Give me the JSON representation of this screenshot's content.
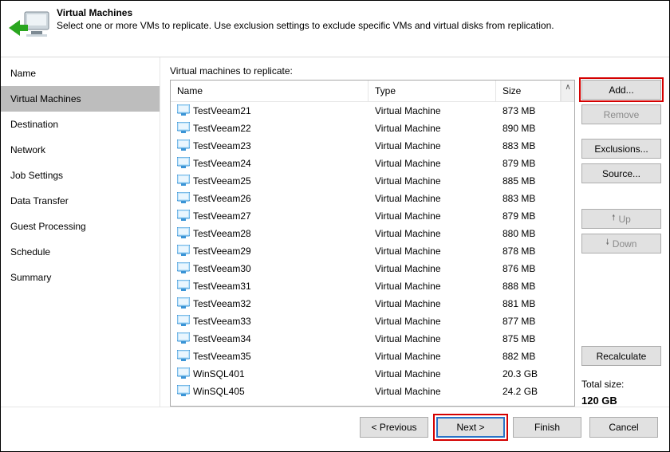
{
  "header": {
    "title": "Virtual Machines",
    "subtitle": "Select one or more VMs to replicate. Use exclusion settings to exclude specific VMs and virtual disks from replication."
  },
  "nav": {
    "items": [
      {
        "label": "Name",
        "selected": false
      },
      {
        "label": "Virtual Machines",
        "selected": true
      },
      {
        "label": "Destination",
        "selected": false
      },
      {
        "label": "Network",
        "selected": false
      },
      {
        "label": "Job Settings",
        "selected": false
      },
      {
        "label": "Data Transfer",
        "selected": false
      },
      {
        "label": "Guest Processing",
        "selected": false
      },
      {
        "label": "Schedule",
        "selected": false
      },
      {
        "label": "Summary",
        "selected": false
      }
    ]
  },
  "main": {
    "caption": "Virtual machines to replicate:",
    "columns": {
      "name": "Name",
      "type": "Type",
      "size": "Size"
    },
    "rows": [
      {
        "name": "TestVeeam21",
        "type": "Virtual Machine",
        "size": "873 MB"
      },
      {
        "name": "TestVeeam22",
        "type": "Virtual Machine",
        "size": "890 MB"
      },
      {
        "name": "TestVeeam23",
        "type": "Virtual Machine",
        "size": "883 MB"
      },
      {
        "name": "TestVeeam24",
        "type": "Virtual Machine",
        "size": "879 MB"
      },
      {
        "name": "TestVeeam25",
        "type": "Virtual Machine",
        "size": "885 MB"
      },
      {
        "name": "TestVeeam26",
        "type": "Virtual Machine",
        "size": "883 MB"
      },
      {
        "name": "TestVeeam27",
        "type": "Virtual Machine",
        "size": "879 MB"
      },
      {
        "name": "TestVeeam28",
        "type": "Virtual Machine",
        "size": "880 MB"
      },
      {
        "name": "TestVeeam29",
        "type": "Virtual Machine",
        "size": "878 MB"
      },
      {
        "name": "TestVeeam30",
        "type": "Virtual Machine",
        "size": "876 MB"
      },
      {
        "name": "TestVeeam31",
        "type": "Virtual Machine",
        "size": "888 MB"
      },
      {
        "name": "TestVeeam32",
        "type": "Virtual Machine",
        "size": "881 MB"
      },
      {
        "name": "TestVeeam33",
        "type": "Virtual Machine",
        "size": "877 MB"
      },
      {
        "name": "TestVeeam34",
        "type": "Virtual Machine",
        "size": "875 MB"
      },
      {
        "name": "TestVeeam35",
        "type": "Virtual Machine",
        "size": "882 MB"
      },
      {
        "name": "WinSQL401",
        "type": "Virtual Machine",
        "size": "20.3 GB"
      },
      {
        "name": "WinSQL405",
        "type": "Virtual Machine",
        "size": "24.2 GB"
      }
    ]
  },
  "buttons": {
    "add": "Add...",
    "remove": "Remove",
    "exclusions": "Exclusions...",
    "source": "Source...",
    "up": "Up",
    "down": "Down",
    "recalculate": "Recalculate",
    "total_label": "Total size:",
    "total_value": "120 GB"
  },
  "footer": {
    "previous": "< Previous",
    "next": "Next >",
    "finish": "Finish",
    "cancel": "Cancel"
  }
}
